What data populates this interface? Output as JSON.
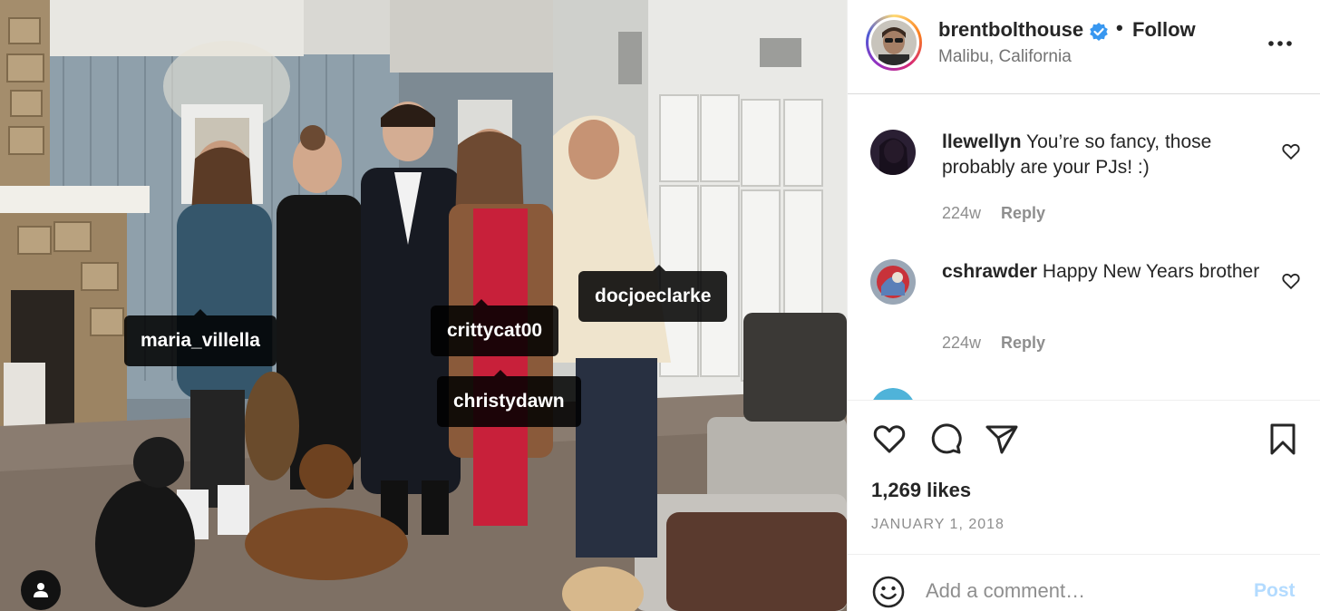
{
  "photo": {
    "tags": [
      {
        "id": "maria",
        "username": "maria_villella"
      },
      {
        "id": "critty",
        "username": "crittycat00"
      },
      {
        "id": "christy",
        "username": "christydawn"
      },
      {
        "id": "doc",
        "username": "docjoeclarke"
      }
    ],
    "tags_button_icon": "user-icon"
  },
  "post_header": {
    "username": "brentbolthouse",
    "verified_icon": "verified-badge-icon",
    "separator": "•",
    "follow_label": "Follow",
    "location": "Malibu, California",
    "more_icon": "more-options-icon"
  },
  "comments": [
    {
      "username": "llewellyn",
      "text": "You’re so fancy, those probably are your PJs! :)",
      "age": "224w",
      "reply_label": "Reply"
    },
    {
      "username": "cshrawder",
      "text": "Happy New Years brother",
      "age": "224w",
      "reply_label": "Reply"
    }
  ],
  "actions": {
    "like_icon": "heart-icon",
    "comment_icon": "comment-icon",
    "share_icon": "share-icon",
    "save_icon": "bookmark-icon",
    "likes_text": "1,269 likes",
    "date_text": "JANUARY 1, 2018"
  },
  "add_comment": {
    "emoji_icon": "emoji-icon",
    "placeholder": "Add a comment…",
    "post_label": "Post"
  },
  "colors": {
    "verified": "#3897f0",
    "post_disabled": "#b3dbff",
    "secondary_text": "#8e8e8e"
  }
}
